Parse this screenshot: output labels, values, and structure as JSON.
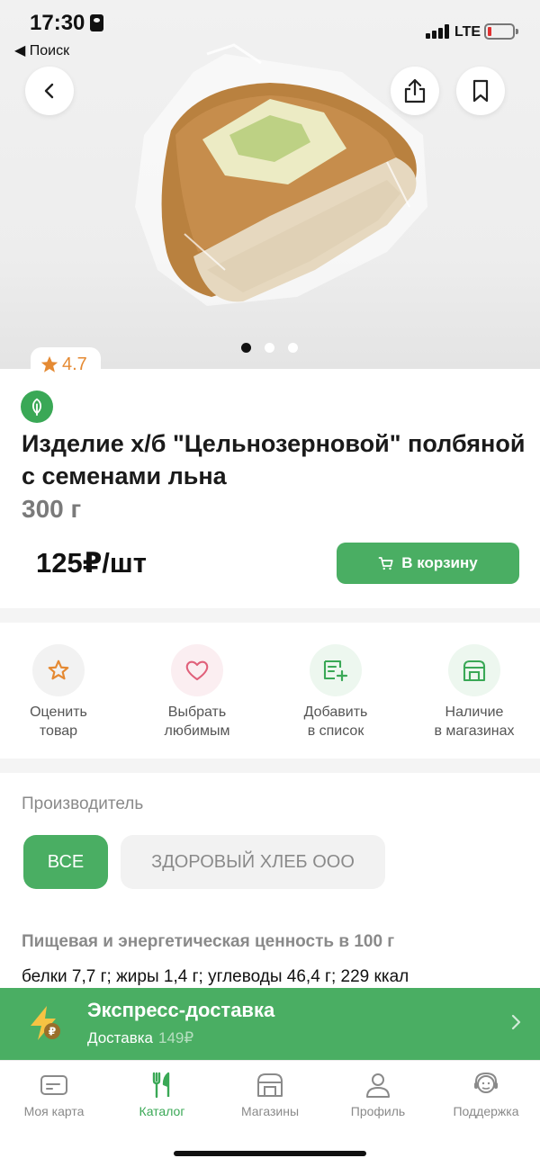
{
  "status_bar": {
    "time": "17:30",
    "back_app": "◀ Поиск",
    "network": "LTE"
  },
  "hero": {
    "rating": "4.7",
    "image_count": 3,
    "active_image": 1
  },
  "product": {
    "title": "Изделие х/б \"Цельнозерновой\" полбяной с семенами льна",
    "weight": "300 г",
    "price": "125₽/шт",
    "cart_label": "В корзину"
  },
  "actions": [
    {
      "label": "Оценить\nтовар",
      "icon": "star-icon"
    },
    {
      "label": "Выбрать\nлюбимым",
      "icon": "heart-icon"
    },
    {
      "label": "Добавить\nв список",
      "icon": "list-add-icon"
    },
    {
      "label": "Наличие\nв магазинах",
      "icon": "store-icon"
    }
  ],
  "manufacturer": {
    "label": "Производитель",
    "chips": [
      "ВСЕ",
      "ЗДОРОВЫЙ ХЛЕБ ООО"
    ]
  },
  "nutrition": {
    "title": "Пищевая и энергетическая ценность в 100 г",
    "value": "белки 7,7 г; жиры 1,4 г; углеводы 46,4 г; 229 ккал"
  },
  "express": {
    "title": "Экспресс-доставка",
    "subtitle": "Доставка",
    "price": "149₽"
  },
  "tabbar": [
    {
      "label": "Моя карта",
      "icon": "card-icon"
    },
    {
      "label": "Каталог",
      "icon": "catalog-icon",
      "active": true
    },
    {
      "label": "Магазины",
      "icon": "store-icon"
    },
    {
      "label": "Профиль",
      "icon": "profile-icon"
    },
    {
      "label": "Поддержка",
      "icon": "support-icon"
    }
  ],
  "colors": {
    "accent": "#4aae63",
    "rating": "#e58a33",
    "heart": "#e0607a"
  }
}
